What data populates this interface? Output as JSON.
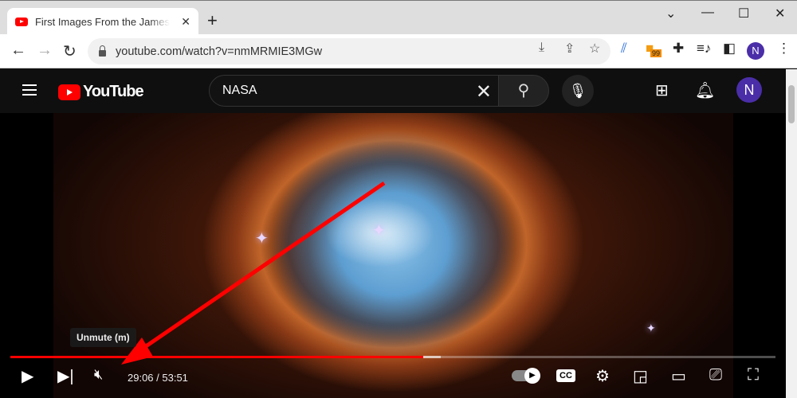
{
  "browser": {
    "tab_title": "First Images From the James Webb Space Telescope",
    "url": "youtube.com/watch?v=nmMRMIE3MGw",
    "extension_badge": "99",
    "profile_initial": "N"
  },
  "youtube": {
    "logo_text": "YouTube",
    "search_value": "NASA",
    "avatar_initial": "N"
  },
  "player": {
    "tooltip": "Unmute (m)",
    "current_time": "29:06",
    "duration": "53:51",
    "time_display": "29:06 / 53:51",
    "progress_fraction": 0.54,
    "buffered_fraction": 0.562,
    "cc_label": "CC"
  },
  "colors": {
    "accent": "#ff0000",
    "avatar": "#4a2ea8"
  }
}
